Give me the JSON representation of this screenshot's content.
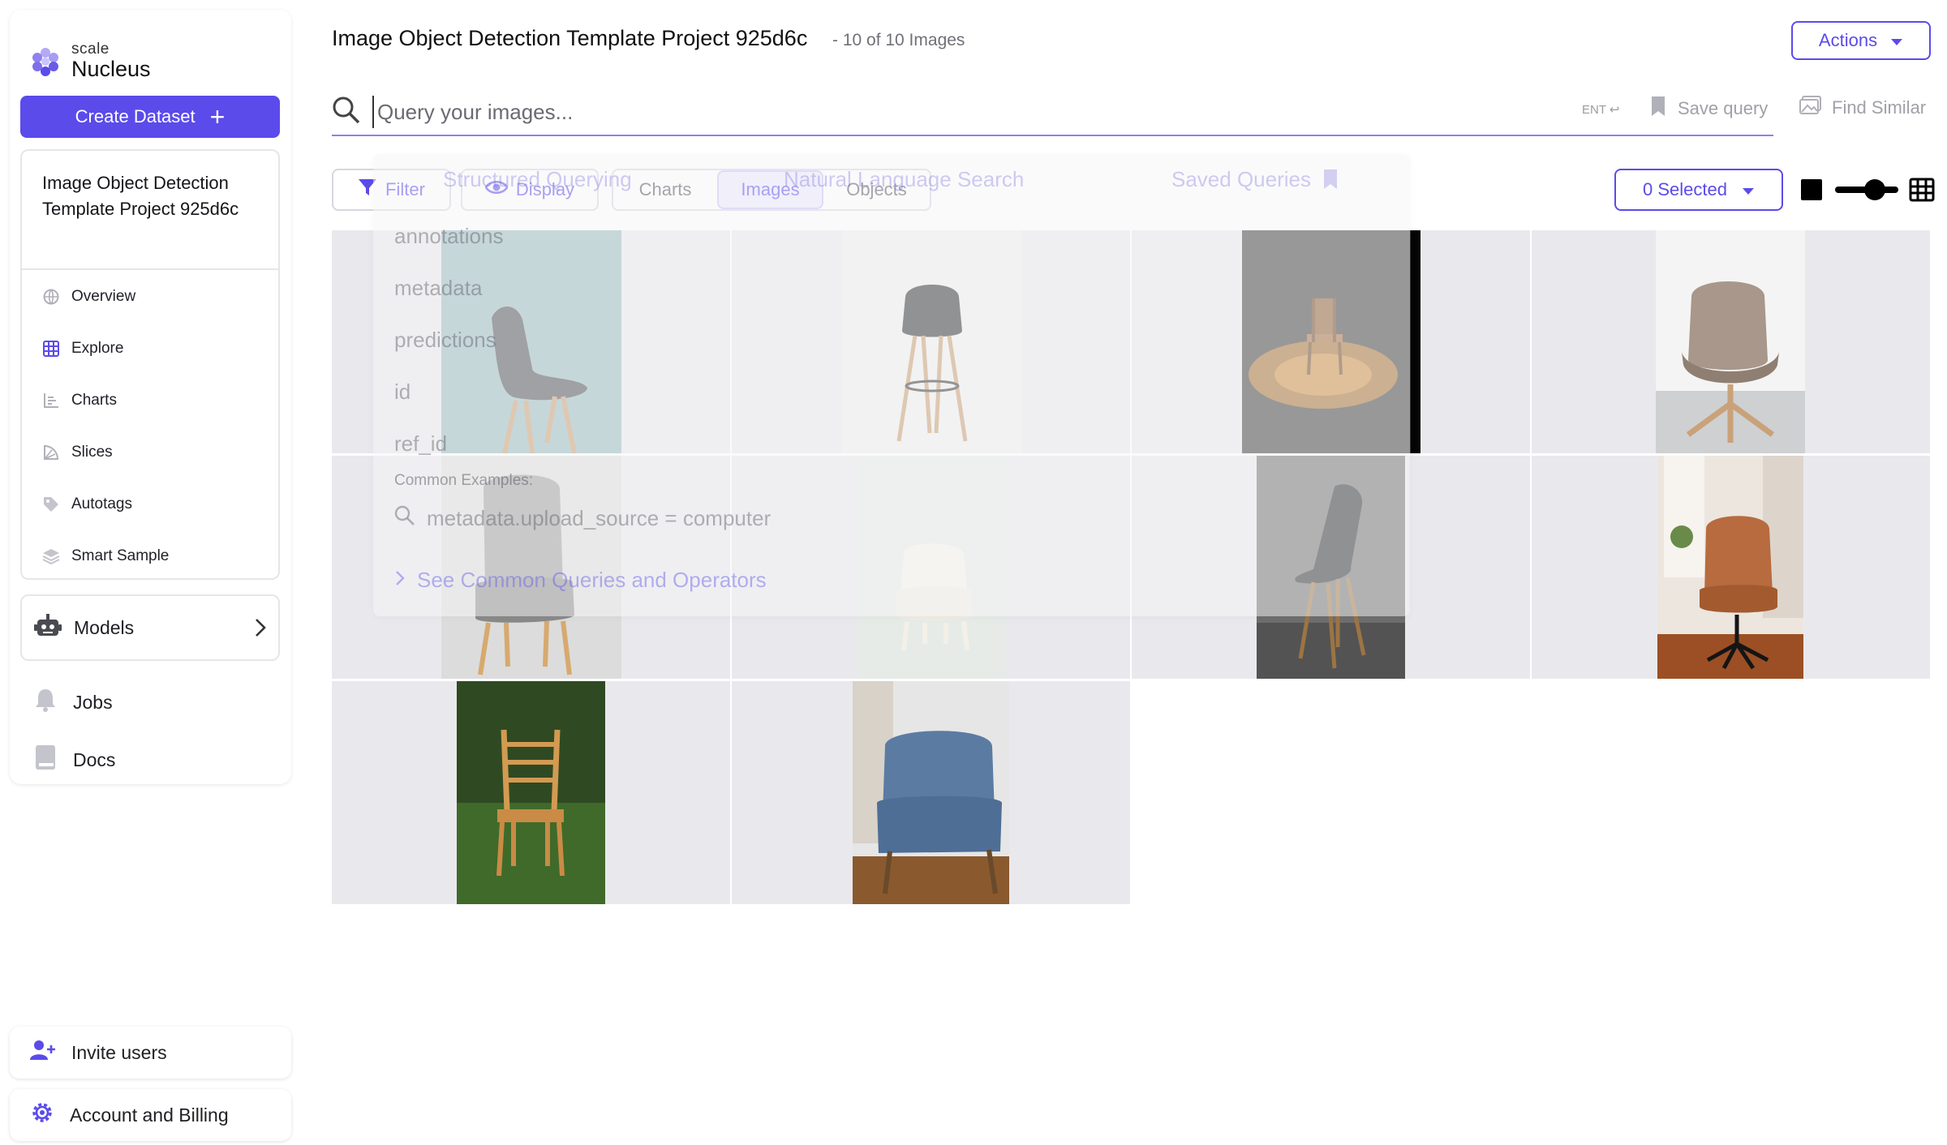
{
  "brand": {
    "scale": "scale",
    "product": "Nucleus"
  },
  "sidebar": {
    "create_label": "Create Dataset",
    "project_title": "Image Object Detection Template Project 925d6c",
    "items": [
      {
        "label": "Overview",
        "icon": "globe-icon"
      },
      {
        "label": "Explore",
        "icon": "grid-icon"
      },
      {
        "label": "Charts",
        "icon": "chart-icon"
      },
      {
        "label": "Slices",
        "icon": "slices-icon"
      },
      {
        "label": "Autotags",
        "icon": "tag-icon"
      },
      {
        "label": "Smart Sample",
        "icon": "layers-icon"
      }
    ],
    "models_label": "Models",
    "jobs_label": "Jobs",
    "docs_label": "Docs",
    "invite_label": "Invite users",
    "account_label": "Account and Billing"
  },
  "header": {
    "title": "Image Object Detection Template Project 925d6c",
    "count": "- 10 of 10 Images",
    "actions_label": "Actions"
  },
  "search": {
    "placeholder": "Query your images...",
    "enter_hint": "ENT",
    "save_query": "Save query",
    "find_similar": "Find Similar"
  },
  "toolbar": {
    "filter": "Filter",
    "display": "Display",
    "tabs": [
      "Charts",
      "Images",
      "Objects"
    ],
    "active_tab": "Images",
    "selected": "0 Selected"
  },
  "query_helper": {
    "tabs": [
      "Structured Querying",
      "Natural Language Search",
      "Saved Queries"
    ],
    "fields": [
      "annotations",
      "metadata",
      "predictions",
      "id",
      "ref_id"
    ],
    "examples_label": "Common Examples:",
    "example": "metadata.upload_source = computer",
    "link": "See Common Queries and Operators"
  },
  "colors": {
    "accent": "#5b4bea",
    "tile_bg": "#e9e9ed"
  },
  "images": [
    {
      "name": "grey-plastic-chair-teal-wall"
    },
    {
      "name": "black-shell-barstool"
    },
    {
      "name": "wooden-chair-spotlight"
    },
    {
      "name": "beige-swivel-chair"
    },
    {
      "name": "grey-upholstered-chair"
    },
    {
      "name": "white-tufted-chair"
    },
    {
      "name": "dark-shell-chair-wood-legs"
    },
    {
      "name": "brown-leather-office-chair"
    },
    {
      "name": "wooden-chair-on-grass"
    },
    {
      "name": "blue-armchair-living-room"
    }
  ]
}
